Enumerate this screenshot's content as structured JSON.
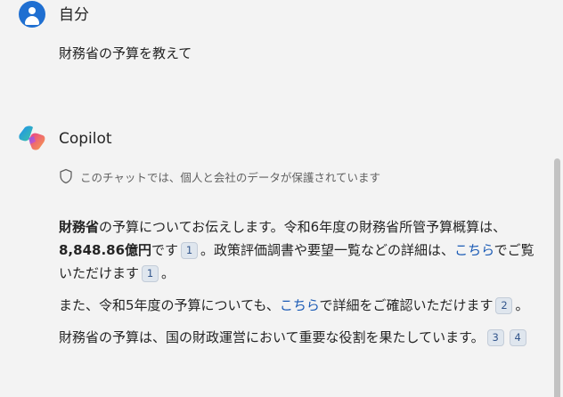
{
  "user": {
    "name": "自分",
    "message": "財務省の予算を教えて"
  },
  "copilot": {
    "name": "Copilot",
    "privacy_notice": "このチャットでは、個人と会社のデータが保護されています",
    "para1": {
      "bold_lead": "財務省",
      "text_a": "の予算についてお伝えします。令和6年度の財務省所管予算概算は、",
      "bold_amount": "8,848.86億円",
      "text_b": "です",
      "ref_a": "1",
      "text_c": "。政策評価調書や要望一覧などの詳細は、",
      "link": "こちら",
      "text_d": "でご覧いただけます",
      "ref_b": "1",
      "text_e": "。"
    },
    "para2": {
      "text_a": "また、令和5年度の予算についても、",
      "link": "こちら",
      "text_b": "で詳細をご確認いただけます",
      "ref": "2",
      "text_c": "。"
    },
    "para3": {
      "text": "財務省の予算は、国の財政運営において重要な役割を果たしています。",
      "ref_a": "3",
      "ref_b": "4"
    }
  },
  "icons": {
    "user_avatar": "person-avatar-icon",
    "copilot_logo": "copilot-logo-icon",
    "privacy": "shield-icon"
  },
  "colors": {
    "background": "#f3f3f3",
    "avatar": "#1f6fd1",
    "link": "#1a5ab5",
    "citation_badge": "#dfe6ee"
  }
}
